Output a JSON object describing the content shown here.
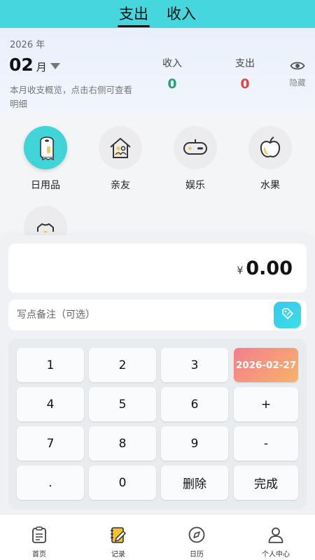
{
  "header": {
    "tabs": [
      {
        "label": "支出",
        "active": true
      },
      {
        "label": "收入",
        "active": false
      }
    ]
  },
  "summary": {
    "year": "2026 年",
    "month": "02",
    "month_unit": "月",
    "description": "本月收支概览，点击右侧可查看明细",
    "income_label": "收入",
    "income_value": "0",
    "expense_label": "支出",
    "expense_value": "0",
    "hide_label": "隐藏"
  },
  "categories": [
    {
      "label": "日用品",
      "icon": "toilet-paper-icon",
      "active": true
    },
    {
      "label": "亲友",
      "icon": "family-house-icon",
      "active": false
    },
    {
      "label": "娱乐",
      "icon": "gamepad-icon",
      "active": false
    },
    {
      "label": "水果",
      "icon": "apple-icon",
      "active": false
    },
    {
      "label": "",
      "icon": "clothes-icon",
      "active": false
    }
  ],
  "entry": {
    "currency": "¥",
    "amount": "0.00",
    "note_placeholder": "写点备注（可选）"
  },
  "keypad": {
    "k1": "1",
    "k2": "2",
    "k3": "3",
    "date": "2026-02-27",
    "k4": "4",
    "k5": "5",
    "k6": "6",
    "plus": "+",
    "k7": "7",
    "k8": "8",
    "k9": "9",
    "minus": "-",
    "dot": ".",
    "k0": "0",
    "delete": "删除",
    "done": "完成"
  },
  "nav": [
    {
      "label": "首页",
      "icon": "clipboard-icon"
    },
    {
      "label": "记录",
      "icon": "notebook-pen-icon",
      "active": true
    },
    {
      "label": "日历",
      "icon": "compass-icon"
    },
    {
      "label": "个人中心",
      "icon": "user-icon"
    }
  ],
  "colors": {
    "accent": "#46d6dd",
    "income": "#22a37a",
    "expense": "#e0483f",
    "date_gradient_start": "#f37e8e",
    "date_gradient_end": "#f8b26a"
  }
}
